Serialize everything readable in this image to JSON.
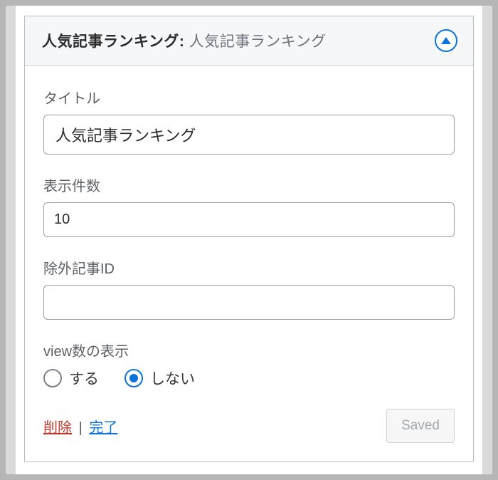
{
  "widget": {
    "title": "人気記事ランキング",
    "subtitle": "人気記事ランキング"
  },
  "form": {
    "title_label": "タイトル",
    "title_value": "人気記事ランキング",
    "count_label": "表示件数",
    "count_value": "10",
    "exclude_label": "除外記事ID",
    "exclude_value": "",
    "view_label": "view数の表示",
    "view_option_yes": "する",
    "view_option_no": "しない"
  },
  "footer": {
    "delete": "削除",
    "done": "完了",
    "saved": "Saved"
  }
}
